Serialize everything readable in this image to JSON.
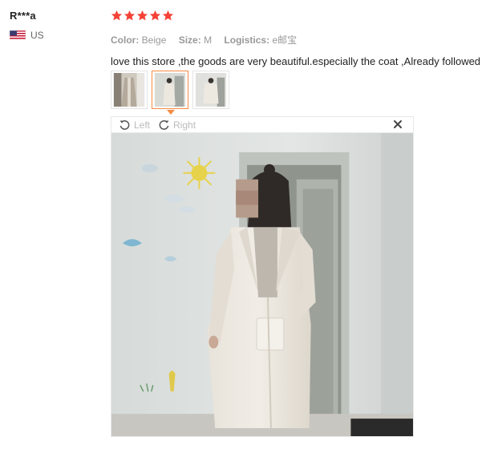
{
  "review": {
    "user_name": "R***a",
    "country": "US",
    "rating": 5,
    "attributes": [
      {
        "key": "Color:",
        "value": "Beige"
      },
      {
        "key": "Size:",
        "value": "M"
      },
      {
        "key": "Logistics:",
        "value": "e邮宝"
      }
    ],
    "text": "love this store ,the goods are very beautiful.especially the coat ,Already followed"
  },
  "thumbnails": {
    "count": 3,
    "active_index": 1
  },
  "viewer": {
    "rotate_left_label": "Left",
    "rotate_right_label": "Right",
    "close_icon": "close-icon"
  },
  "colors": {
    "star": "#f44336",
    "active_border": "#f58b45"
  }
}
